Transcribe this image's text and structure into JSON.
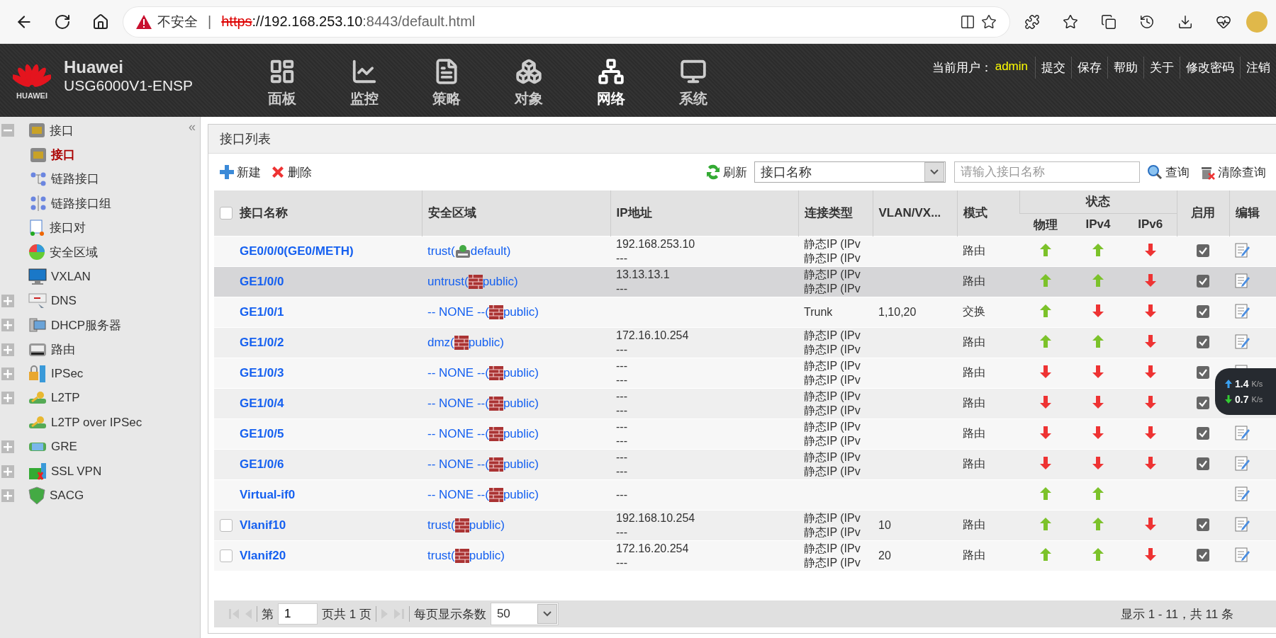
{
  "browser": {
    "security_label": "不安全",
    "separator": "|",
    "url_scheme": "https",
    "url_host": "://192.168.253.10",
    "url_rest": ":8443/default.html"
  },
  "header": {
    "brand": "Huawei",
    "logo_text": "HUAWEI",
    "model": "USG6000V1-ENSP",
    "nav": [
      {
        "label": "面板",
        "kind": "dashboard",
        "selected": false
      },
      {
        "label": "监控",
        "kind": "monitor",
        "selected": false
      },
      {
        "label": "策略",
        "kind": "policy",
        "selected": false
      },
      {
        "label": "对象",
        "kind": "object",
        "selected": false
      },
      {
        "label": "网络",
        "kind": "network",
        "selected": true
      },
      {
        "label": "系统",
        "kind": "system",
        "selected": false
      }
    ],
    "user_label": "当前用户：",
    "user": "admin",
    "actions": [
      "提交",
      "保存",
      "帮助",
      "关于",
      "修改密码",
      "注销"
    ]
  },
  "sidebar": {
    "collapse": "«",
    "items": [
      {
        "label": "接口",
        "kind": "port",
        "expanded": true,
        "selected": false,
        "children": [
          {
            "label": "接口",
            "kind": "port",
            "selected": true
          },
          {
            "label": "链路接口",
            "kind": "link",
            "selected": false
          },
          {
            "label": "链路接口组",
            "kind": "link-group",
            "selected": false
          }
        ]
      },
      {
        "label": "接口对",
        "kind": "pair",
        "selected": false
      },
      {
        "label": "安全区域",
        "kind": "zone",
        "selected": false
      },
      {
        "label": "VXLAN",
        "kind": "vxlan",
        "selected": false
      },
      {
        "label": "DNS",
        "kind": "dns",
        "expanded": false,
        "selected": false
      },
      {
        "label": "DHCP服务器",
        "kind": "dhcp",
        "expanded": false,
        "selected": false
      },
      {
        "label": "路由",
        "kind": "route",
        "expanded": false,
        "selected": false
      },
      {
        "label": "IPSec",
        "kind": "ipsec",
        "expanded": false,
        "selected": false
      },
      {
        "label": "L2TP",
        "kind": "l2tp",
        "expanded": false,
        "selected": false
      },
      {
        "label": "L2TP over IPSec",
        "kind": "l2tp",
        "selected": false
      },
      {
        "label": "GRE",
        "kind": "gre",
        "expanded": false,
        "selected": false
      },
      {
        "label": "SSL VPN",
        "kind": "sslvpn",
        "expanded": false,
        "selected": false
      },
      {
        "label": "SACG",
        "kind": "sacg",
        "expanded": false,
        "selected": false
      }
    ]
  },
  "panel": {
    "title": "接口列表",
    "toolbar": {
      "new": "新建",
      "delete": "删除",
      "refresh": "刷新",
      "filter_field": "接口名称",
      "search_placeholder": "请输入接口名称",
      "search": "查询",
      "clear": "清除查询"
    },
    "table": {
      "header_checked": false,
      "columns": [
        "接口名称",
        "安全区域",
        "IP地址",
        "连接类型",
        "VLAN/VX...",
        "模式",
        "状态",
        "物理",
        "IPv4",
        "IPv6",
        "启用",
        "编辑"
      ],
      "rows": [
        {
          "name": "GE0/0/0(GE0/METH)",
          "zone": "trust(",
          "vsys": {
            "kind": "default",
            "text": " default)"
          },
          "ip": [
            "192.168.253.10",
            "---"
          ],
          "conn": [
            "静态IP (IPv",
            "静态IP (IPv"
          ],
          "mode": "路由",
          "status": [
            {
              "up": true
            },
            {
              "up": true
            },
            {
              "up": false
            }
          ],
          "enabled": true,
          "selected": false
        },
        {
          "name": "GE1/0/0",
          "zone": "untrust(",
          "vsys": {
            "kind": "public",
            "text": " public)"
          },
          "ip": [
            "13.13.13.1",
            "---"
          ],
          "conn": [
            "静态IP (IPv",
            "静态IP (IPv"
          ],
          "mode": "路由",
          "status": [
            {
              "up": true
            },
            {
              "up": true
            },
            {
              "up": false
            }
          ],
          "enabled": true,
          "selected": true
        },
        {
          "name": "GE1/0/1",
          "zone": "-- NONE --(",
          "vsys": {
            "kind": "public",
            "text": " public)"
          },
          "conn": [
            "Trunk"
          ],
          "vlan": "1,10,20",
          "mode": "交换",
          "status": [
            {
              "up": true
            },
            {
              "up": false
            },
            {
              "up": false
            }
          ],
          "enabled": true,
          "selected": false
        },
        {
          "name": "GE1/0/2",
          "zone": "dmz(",
          "vsys": {
            "kind": "public",
            "text": " public)"
          },
          "ip": [
            "172.16.10.254",
            "---"
          ],
          "conn": [
            "静态IP (IPv",
            "静态IP (IPv"
          ],
          "mode": "路由",
          "status": [
            {
              "up": true
            },
            {
              "up": true
            },
            {
              "up": false
            }
          ],
          "enabled": true,
          "selected": false
        },
        {
          "name": "GE1/0/3",
          "zone": "-- NONE --(",
          "vsys": {
            "kind": "public",
            "text": " public)"
          },
          "ip": [
            "---",
            "---"
          ],
          "conn": [
            "静态IP (IPv",
            "静态IP (IPv"
          ],
          "mode": "路由",
          "status": [
            {
              "up": false
            },
            {
              "up": false
            },
            {
              "up": false
            }
          ],
          "enabled": true,
          "selected": false
        },
        {
          "name": "GE1/0/4",
          "zone": "-- NONE --(",
          "vsys": {
            "kind": "public",
            "text": " public)"
          },
          "ip": [
            "---",
            "---"
          ],
          "conn": [
            "静态IP (IPv",
            "静态IP (IPv"
          ],
          "mode": "路由",
          "status": [
            {
              "up": false
            },
            {
              "up": false
            },
            {
              "up": false
            }
          ],
          "enabled": true,
          "selected": false
        },
        {
          "name": "GE1/0/5",
          "zone": "-- NONE --(",
          "vsys": {
            "kind": "public",
            "text": " public)"
          },
          "ip": [
            "---",
            "---"
          ],
          "conn": [
            "静态IP (IPv",
            "静态IP (IPv"
          ],
          "mode": "路由",
          "status": [
            {
              "up": false
            },
            {
              "up": false
            },
            {
              "up": false
            }
          ],
          "enabled": true,
          "selected": false
        },
        {
          "name": "GE1/0/6",
          "zone": "-- NONE --(",
          "vsys": {
            "kind": "public",
            "text": " public)"
          },
          "ip": [
            "---",
            "---"
          ],
          "conn": [
            "静态IP (IPv",
            "静态IP (IPv"
          ],
          "mode": "路由",
          "status": [
            {
              "up": false
            },
            {
              "up": false
            },
            {
              "up": false
            }
          ],
          "enabled": true,
          "selected": false
        },
        {
          "name": "Virtual-if0",
          "zone": "-- NONE --(",
          "vsys": {
            "kind": "public",
            "text": " public)"
          },
          "ip": [
            "---"
          ],
          "status": [
            {
              "up": true
            },
            {
              "up": true
            }
          ],
          "enabled": false,
          "selected": false
        },
        {
          "name": "Vlanif10",
          "checked": false,
          "zone": "trust(",
          "vsys": {
            "kind": "public",
            "text": " public)"
          },
          "ip": [
            "192.168.10.254",
            "---"
          ],
          "conn": [
            "静态IP (IPv",
            "静态IP (IPv"
          ],
          "vlan": "10",
          "mode": "路由",
          "status": [
            {
              "up": true
            },
            {
              "up": true
            },
            {
              "up": false
            }
          ],
          "enabled": true,
          "selected": false
        },
        {
          "name": "Vlanif20",
          "checked": false,
          "zone": "trust(",
          "vsys": {
            "kind": "public",
            "text": " public)"
          },
          "ip": [
            "172.16.20.254",
            "---"
          ],
          "conn": [
            "静态IP (IPv",
            "静态IP (IPv"
          ],
          "vlan": "20",
          "mode": "路由",
          "status": [
            {
              "up": true
            },
            {
              "up": true
            },
            {
              "up": false
            }
          ],
          "enabled": true,
          "selected": false
        }
      ]
    },
    "pager": {
      "page_prefix": "第",
      "page": "1",
      "page_suffix": "页共 1 页",
      "per_page_label": "每页显示条数",
      "per_page": "50",
      "summary": "显示 1 - 11，共 11 条"
    }
  },
  "speed": {
    "up": "1.4",
    "up_unit": "K/s",
    "down": "0.7",
    "down_unit": "K/s"
  }
}
